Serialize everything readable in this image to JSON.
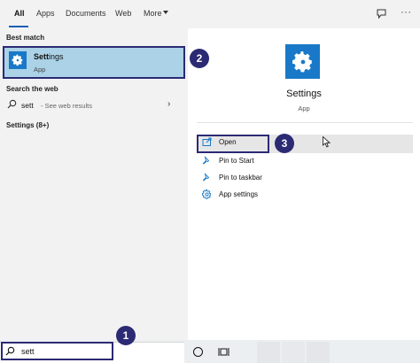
{
  "tabs": {
    "all": "All",
    "apps": "Apps",
    "documents": "Documents",
    "web": "Web",
    "more": "More"
  },
  "left": {
    "best_match_heading": "Best match",
    "best_match": {
      "title_bold": "Sett",
      "title_rest": "ings",
      "subtitle": "App"
    },
    "web_heading": "Search the web",
    "web_result": {
      "query": "sett",
      "hint": "- See web results"
    },
    "settings_heading": "Settings (8+)"
  },
  "right": {
    "title": "Settings",
    "subtitle": "App",
    "actions": {
      "open": "Open",
      "pin_start": "Pin to Start",
      "pin_taskbar": "Pin to taskbar",
      "app_settings": "App settings"
    }
  },
  "taskbar": {
    "search_value": "sett"
  },
  "badges": {
    "one": "1",
    "two": "2",
    "three": "3"
  },
  "colors": {
    "accent": "#1979c8",
    "highlight": "#abd2e6",
    "annotation": "#2b2a73"
  },
  "icons": [
    "feedback-icon",
    "more-options-icon",
    "gear-icon",
    "search-icon",
    "chevron-right-icon",
    "open-icon",
    "pin-icon",
    "cortana-icon",
    "task-view-icon",
    "cursor-icon"
  ]
}
